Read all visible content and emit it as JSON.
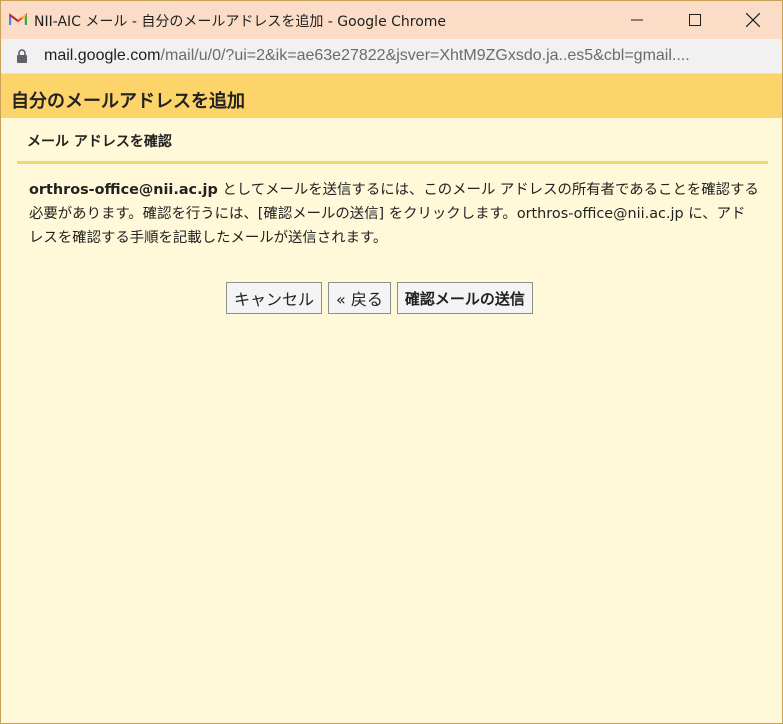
{
  "window": {
    "title": "NII-AIC メール - 自分のメールアドレスを追加 - Google Chrome"
  },
  "urlbar": {
    "host": "mail.google.com",
    "path": "/mail/u/0/?ui=2&ik=ae63e27822&jsver=XhtM9ZGxsdo.ja..es5&cbl=gmail...."
  },
  "header": {
    "title": "自分のメールアドレスを追加"
  },
  "section": {
    "title": "メール アドレスを確認"
  },
  "message": {
    "email": "orthros-office@nii.ac.jp",
    "text": " としてメールを送信するには、このメール アドレスの所有者であることを確認する必要があります。確認を行うには、[確認メールの送信] をクリックします。orthros-office@nii.ac.jp に、アドレスを確認する手順を記載したメールが送信されます。"
  },
  "buttons": {
    "cancel": "キャンセル",
    "back": "« 戻る",
    "send": "確認メールの送信"
  },
  "colors": {
    "titlebar": "#fbdcc7",
    "header": "#fcd469",
    "background": "#fff9d9",
    "divider": "#f5d66e"
  }
}
